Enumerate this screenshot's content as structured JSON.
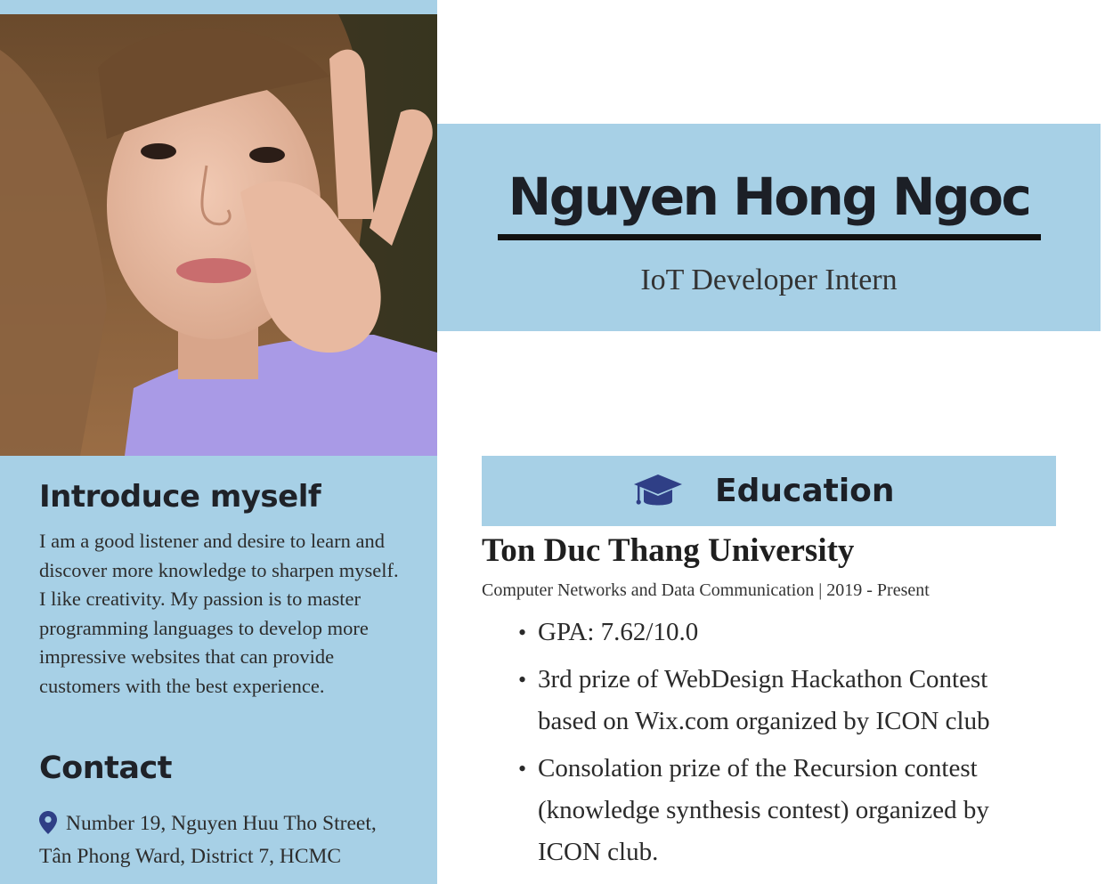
{
  "profile": {
    "name": "Nguyen Hong Ngoc",
    "job_title": "IoT Developer Intern"
  },
  "intro": {
    "heading": "Introduce myself",
    "text": "I am a good listener and desire to learn and discover more knowledge to sharpen myself. I like creativity. My passion is to master programming languages to develop more impressive websites that can provide customers with the best experience."
  },
  "contact": {
    "heading": "Contact",
    "address": "Number 19, Nguyen Huu Tho Street, Tân Phong Ward, District 7, HCMC",
    "icon": "map-pin-icon"
  },
  "education": {
    "heading": "Education",
    "icon": "graduation-cap-icon",
    "school": "Ton Duc Thang University",
    "meta": "Computer Networks and Data Communication | 2019 - Present",
    "items": [
      "GPA: 7.62/10.0",
      "3rd prize of WebDesign Hackathon Contest based on Wix.com organized by ICON club",
      "Consolation prize of the Recursion contest (knowledge synthesis contest) organized by ICON club."
    ]
  },
  "colors": {
    "accent_blue": "#a7d0e6",
    "icon_navy": "#2f3f86",
    "text_dark": "#1c1f26"
  }
}
